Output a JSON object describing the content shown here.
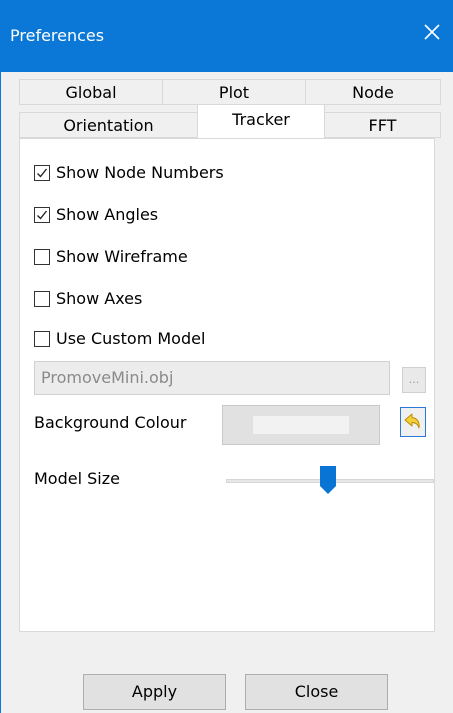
{
  "window": {
    "title": "Preferences"
  },
  "tabs": {
    "row1": [
      {
        "label": "Global"
      },
      {
        "label": "Plot"
      },
      {
        "label": "Node"
      }
    ],
    "row2": [
      {
        "label": "Orientation"
      },
      {
        "label": "Tracker",
        "active": true
      },
      {
        "label": "FFT"
      }
    ]
  },
  "options": [
    {
      "label": "Show Node Numbers",
      "checked": true
    },
    {
      "label": "Show Angles",
      "checked": true
    },
    {
      "label": "Show Wireframe",
      "checked": false
    },
    {
      "label": "Show Axes",
      "checked": false
    },
    {
      "label": "Use Custom Model",
      "checked": false
    }
  ],
  "model_file": {
    "value": "PromoveMini.obj",
    "browse_label": "..."
  },
  "background": {
    "label": "Background Colour",
    "color": "#f2f2f2"
  },
  "model_size": {
    "label": "Model Size",
    "value_fraction": 0.5
  },
  "buttons": {
    "apply": "Apply",
    "close": "Close"
  },
  "colors": {
    "titlebar": "#0b78d7",
    "accent": "#0b78d7"
  }
}
